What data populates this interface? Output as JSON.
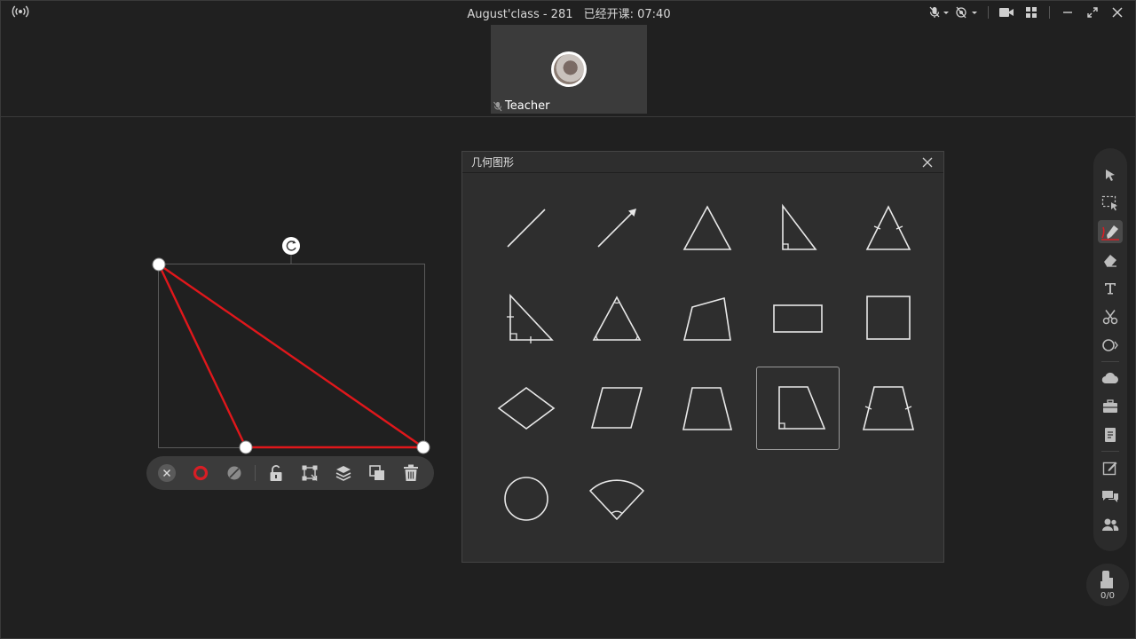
{
  "topbar": {
    "class_name": "August'class - 281",
    "class_time": "已经开课: 07:40"
  },
  "video": {
    "name": "Teacher"
  },
  "shapes_panel": {
    "title": "几何图形",
    "selected_shape": "right-trapezoid"
  },
  "hands": {
    "count": "0/0"
  },
  "colors": {
    "stroke_red": "#e0171b",
    "accent_red": "#d81e25",
    "icon_gray": "#bdbdbd",
    "panel_bg": "#2e2e2e"
  }
}
